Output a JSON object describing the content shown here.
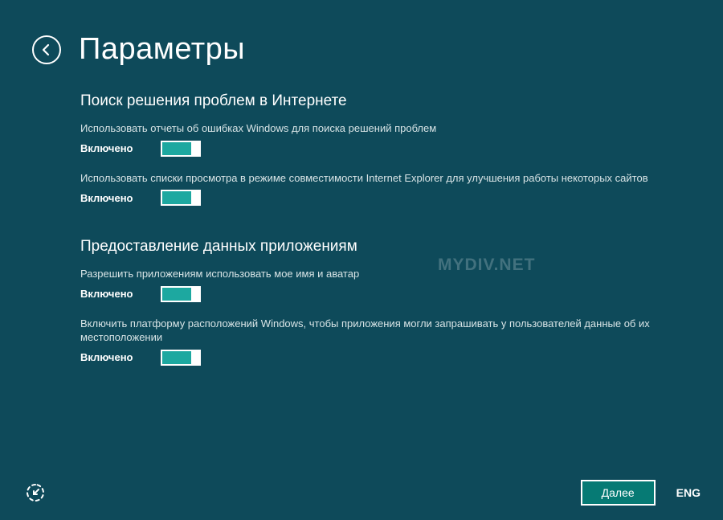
{
  "page_title": "Параметры",
  "sections": [
    {
      "title": "Поиск решения проблем в Интернете",
      "options": [
        {
          "desc": "Использовать отчеты об ошибках Windows для поиска решений проблем",
          "state": "Включено"
        },
        {
          "desc": "Использовать списки просмотра в режиме совместимости Internet Explorer для улучшения работы некоторых сайтов",
          "state": "Включено"
        }
      ]
    },
    {
      "title": "Предоставление данных приложениям",
      "options": [
        {
          "desc": "Разрешить приложениям использовать мое имя и аватар",
          "state": "Включено"
        },
        {
          "desc": "Включить платформу расположений Windows, чтобы приложения могли запрашивать у пользователей данные об их местоположении",
          "state": "Включено"
        }
      ]
    }
  ],
  "next_button": "Далее",
  "language_indicator": "ENG",
  "watermark": "MYDIV.NET"
}
